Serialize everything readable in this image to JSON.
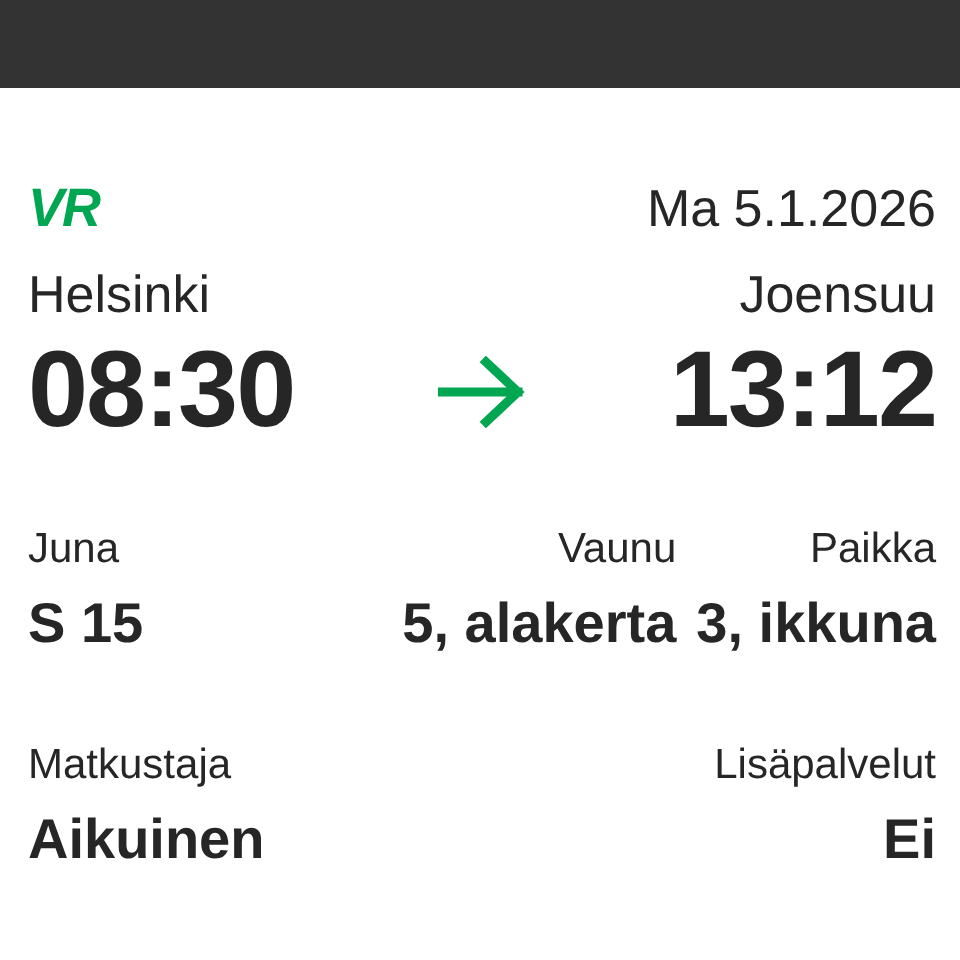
{
  "logo": "VR",
  "date": "Ma 5.1.2026",
  "route": {
    "from": {
      "city": "Helsinki",
      "time": "08:30"
    },
    "to": {
      "city": "Joensuu",
      "time": "13:12"
    }
  },
  "details": [
    {
      "label": "Juna",
      "value": "S 15"
    },
    {
      "label": "Vaunu",
      "value": "5, alakerta"
    },
    {
      "label": "Paikka",
      "value": "3, ikkuna"
    }
  ],
  "extra": [
    {
      "label": "Matkustaja",
      "value": "Aikuinen"
    },
    {
      "label": "Lisäpalvelut",
      "value": "Ei"
    }
  ]
}
